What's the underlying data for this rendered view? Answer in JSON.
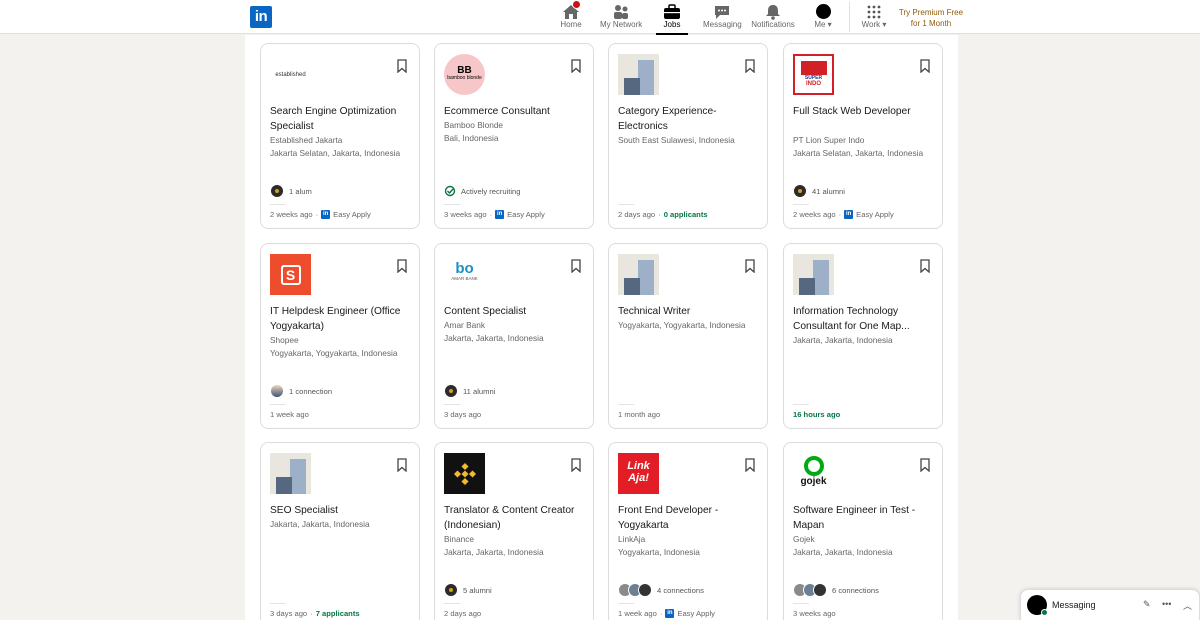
{
  "nav": {
    "logo": "in",
    "items": [
      {
        "key": "home",
        "label": "Home",
        "icon": "home-icon"
      },
      {
        "key": "network",
        "label": "My Network",
        "icon": "people-icon"
      },
      {
        "key": "jobs",
        "label": "Jobs",
        "icon": "briefcase-icon"
      },
      {
        "key": "messaging",
        "label": "Messaging",
        "icon": "chat-icon"
      },
      {
        "key": "notifications",
        "label": "Notifications",
        "icon": "bell-icon"
      },
      {
        "key": "me",
        "label": "Me",
        "icon": "avatar-icon"
      },
      {
        "key": "work",
        "label": "Work",
        "icon": "grid-icon"
      }
    ],
    "premium_line1": "Try Premium Free",
    "premium_line2": "for 1 Month"
  },
  "jobs": [
    {
      "title": "Search Engine Optimization Specialist",
      "company": "Established Jakarta",
      "location": "Jakarta Selatan, Jakarta, Indonesia",
      "insight": "1 alum",
      "insight_icon": "university-icon",
      "posted": "2 weeks ago",
      "dot": " · ",
      "extra": "Easy Apply",
      "logo": "established",
      "logo_text": "established"
    },
    {
      "title": "Ecommerce Consultant",
      "company": "Bamboo Blonde",
      "location": "Bali, Indonesia",
      "insight": "Actively recruiting",
      "insight_icon": "recruiting-icon",
      "posted": "3 weeks ago",
      "dot": " · ",
      "extra": "Easy Apply",
      "logo": "bamboo",
      "logo_text": "BB",
      "logo_sub": "bamboo blonde"
    },
    {
      "title": "Category Experience- Electronics",
      "company": "South East Sulawesi, Indonesia",
      "location": "",
      "insight": "",
      "insight_icon": "",
      "posted": "2 days ago",
      "dot": " · ",
      "extra_green": "0 applicants",
      "logo": "placeholder"
    },
    {
      "title": "Full Stack Web Developer",
      "company": "PT Lion Super Indo",
      "location": "Jakarta Selatan, Jakarta, Indonesia",
      "insight": "41 alumni",
      "insight_icon": "university-icon",
      "posted": "2 weeks ago",
      "dot": " · ",
      "extra": "Easy Apply",
      "logo": "superindo",
      "logo_text": "SUPER",
      "logo_sub": "INDO"
    },
    {
      "title": "IT Helpdesk Engineer (Office Yogyakarta)",
      "company": "Shopee",
      "location": "Yogyakarta, Yogyakarta, Indonesia",
      "insight": "1 connection",
      "insight_icon": "connection-avatar",
      "posted": "1 week ago",
      "logo": "shopee",
      "logo_text": "S"
    },
    {
      "title": "Content Specialist",
      "company": "Amar Bank",
      "location": "Jakarta, Jakarta, Indonesia",
      "insight": "11 alumni",
      "insight_icon": "university-icon",
      "posted": "3 days ago",
      "logo": "amar",
      "logo_text": "bo",
      "logo_sub": "AMAR BANK"
    },
    {
      "title": "Technical Writer",
      "company": "Yogyakarta, Yogyakarta, Indonesia",
      "location": "",
      "insight": "",
      "insight_icon": "",
      "posted": "1 month ago",
      "logo": "placeholder"
    },
    {
      "title": "Information Technology Consultant for One Map...",
      "company": "Jakarta, Jakarta, Indonesia",
      "location": "",
      "insight": "",
      "insight_icon": "",
      "posted_green": "16 hours ago",
      "logo": "placeholder"
    },
    {
      "title": "SEO Specialist",
      "company": "Jakarta, Jakarta, Indonesia",
      "location": "",
      "insight": "",
      "insight_icon": "",
      "posted": "3 days ago",
      "dot": " · ",
      "extra_green": "7 applicants",
      "logo": "placeholder"
    },
    {
      "title": "Translator & Content Creator (Indonesian)",
      "company": "Binance",
      "location": "Jakarta, Jakarta, Indonesia",
      "insight": "5 alumni",
      "insight_icon": "university-icon",
      "posted": "2 days ago",
      "logo": "binance"
    },
    {
      "title": "Front End Developer - Yogyakarta",
      "company": "LinkAja",
      "location": "Yogyakarta, Indonesia",
      "insight": "4 connections",
      "insight_icon": "connections-avatars",
      "posted": "1 week ago",
      "dot": " · ",
      "extra": "Easy Apply",
      "logo": "linkaja",
      "logo_text": "Link",
      "logo_sub": "Aja!"
    },
    {
      "title": "Software Engineer in Test - Mapan",
      "company": "Gojek",
      "location": "Jakarta, Jakarta, Indonesia",
      "insight": "6 connections",
      "insight_icon": "connections-avatars",
      "posted": "3 weeks ago",
      "logo": "gojek",
      "logo_text": "gojek"
    }
  ],
  "messaging": {
    "label": "Messaging"
  },
  "colors": {
    "brand": "#0a66c2",
    "green": "#057642",
    "premium": "#915907"
  }
}
